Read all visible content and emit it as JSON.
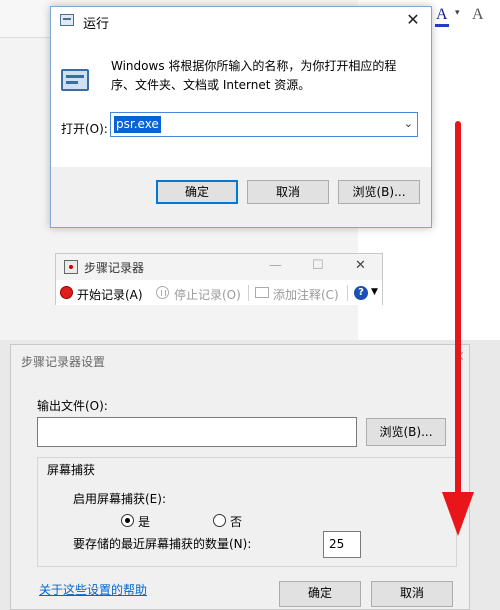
{
  "run_dialog": {
    "title": "运行",
    "close_glyph": "✕",
    "description": "Windows 将根据你所输入的名称，为你打开相应的程序、文件夹、文档或 Internet 资源。",
    "open_label": "打开(O):",
    "open_value": "psr.exe",
    "dropdown_glyph": "⌄",
    "ok_label": "确定",
    "cancel_label": "取消",
    "browse_label": "浏览(B)..."
  },
  "steps_recorder": {
    "title": "步骤记录器",
    "minimize_glyph": "—",
    "maximize_glyph": "☐",
    "close_glyph": "✕",
    "start_label": "开始记录(A)",
    "pause_label": "停止记录(O)",
    "comment_label": "添加注释(C)",
    "help_glyph": "?",
    "help_caret": "▼"
  },
  "settings_dialog": {
    "title": "步骤记录器设置",
    "close_glyph": "✕",
    "output_label": "输出文件(O):",
    "output_value": "",
    "browse_label": "浏览(B)...",
    "capture_group_label": "屏幕捕获",
    "enable_capture_label": "启用屏幕捕获(E):",
    "yes_label": "是",
    "no_label": "否",
    "capture_enabled": true,
    "count_label": "要存储的最近屏幕捕获的数量(N):",
    "count_value": "25",
    "help_link": "关于这些设置的帮助",
    "ok_label": "确定",
    "cancel_label": "取消"
  },
  "background": {
    "font_color_glyph": "A",
    "font_caret": "▾",
    "font_glyph_2": "A"
  },
  "colors": {
    "arrow": "#e8161a",
    "accent": "#0078d7"
  }
}
